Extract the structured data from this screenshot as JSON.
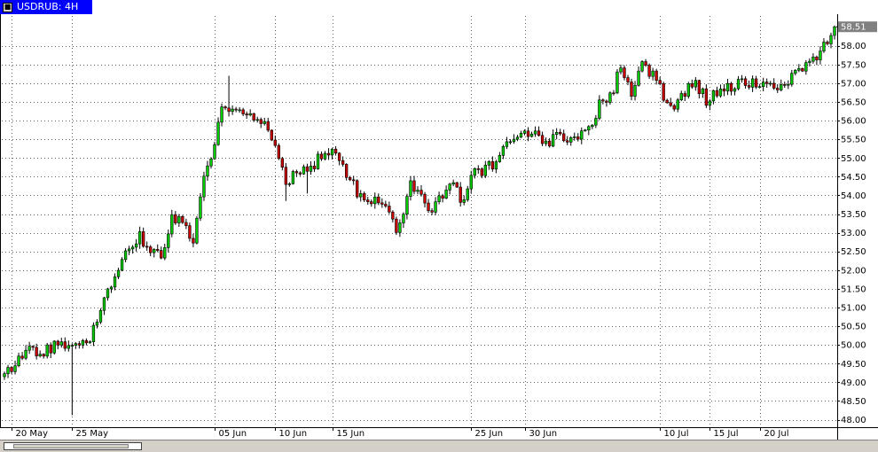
{
  "window": {
    "tab_label": "USDRUB: 4H",
    "tab_icon": "close-icon"
  },
  "chart_data": {
    "type": "candlestick",
    "symbol": "USDRUB",
    "timeframe": "4H",
    "ylim": [
      47.8,
      58.8
    ],
    "y_ticks": [
      48.0,
      48.5,
      49.0,
      49.5,
      50.0,
      50.5,
      51.0,
      51.5,
      52.0,
      52.5,
      53.0,
      53.5,
      54.0,
      54.5,
      55.0,
      55.5,
      56.0,
      56.5,
      57.0,
      57.5,
      58.0
    ],
    "y_tick_labels": [
      "48.00",
      "48.50",
      "49.00",
      "49.50",
      "50.00",
      "50.50",
      "51.00",
      "51.50",
      "52.00",
      "52.50",
      "53.00",
      "53.50",
      "54.00",
      "54.50",
      "55.00",
      "55.50",
      "56.00",
      "56.50",
      "57.00",
      "57.50",
      "58.00"
    ],
    "x_labels": [
      {
        "label": "20 May",
        "bar": 2
      },
      {
        "label": "25 May",
        "bar": 19
      },
      {
        "label": "05 Jun",
        "bar": 59
      },
      {
        "label": "10 Jun",
        "bar": 76
      },
      {
        "label": "15 Jun",
        "bar": 92
      },
      {
        "label": "25 Jun",
        "bar": 131
      },
      {
        "label": "30 Jun",
        "bar": 146
      },
      {
        "label": "10 Jul",
        "bar": 184
      },
      {
        "label": "15 Jul",
        "bar": 198
      },
      {
        "label": "20 Jul",
        "bar": 212
      }
    ],
    "current_price": "58.51",
    "current_value": 58.51,
    "up_color": "#00cc00",
    "down_color": "#cc0000",
    "grid": true,
    "bars_total": 234,
    "anchors": [
      [
        0,
        49.15
      ],
      [
        6,
        49.9
      ],
      [
        10,
        49.75
      ],
      [
        14,
        49.95
      ],
      [
        19,
        50.0
      ],
      [
        24,
        50.2
      ],
      [
        28,
        51.2
      ],
      [
        32,
        52.1
      ],
      [
        36,
        52.7
      ],
      [
        38,
        52.9
      ],
      [
        40,
        52.6
      ],
      [
        44,
        52.4
      ],
      [
        47,
        53.45
      ],
      [
        50,
        53.2
      ],
      [
        53,
        52.75
      ],
      [
        56,
        54.4
      ],
      [
        59,
        55.2
      ],
      [
        61,
        56.45
      ],
      [
        65,
        56.3
      ],
      [
        71,
        56.05
      ],
      [
        75,
        55.6
      ],
      [
        79,
        54.4
      ],
      [
        82,
        54.6
      ],
      [
        86,
        54.7
      ],
      [
        89,
        55.1
      ],
      [
        92,
        55.3
      ],
      [
        95,
        54.8
      ],
      [
        99,
        54.1
      ],
      [
        102,
        53.7
      ],
      [
        105,
        53.95
      ],
      [
        108,
        53.4
      ],
      [
        110,
        53.05
      ],
      [
        112,
        53.4
      ],
      [
        114,
        54.3
      ],
      [
        117,
        54.0
      ],
      [
        120,
        53.5
      ],
      [
        124,
        54.2
      ],
      [
        126,
        54.4
      ],
      [
        128,
        53.8
      ],
      [
        131,
        54.5
      ],
      [
        137,
        54.85
      ],
      [
        141,
        55.35
      ],
      [
        146,
        55.8
      ],
      [
        149,
        55.6
      ],
      [
        152,
        55.3
      ],
      [
        155,
        55.7
      ],
      [
        159,
        55.4
      ],
      [
        164,
        55.7
      ],
      [
        167,
        56.4
      ],
      [
        171,
        56.9
      ],
      [
        173,
        57.4
      ],
      [
        176,
        56.8
      ],
      [
        179,
        57.5
      ],
      [
        182,
        57.2
      ],
      [
        186,
        56.5
      ],
      [
        189,
        56.4
      ],
      [
        192,
        56.9
      ],
      [
        194,
        57.0
      ],
      [
        197,
        56.55
      ],
      [
        201,
        56.85
      ],
      [
        206,
        57.0
      ],
      [
        212,
        57.0
      ],
      [
        218,
        56.95
      ],
      [
        222,
        57.2
      ],
      [
        226,
        57.5
      ],
      [
        230,
        58.05
      ],
      [
        233,
        58.51
      ]
    ],
    "spikes": [
      {
        "bar": 19,
        "low": 48.12
      },
      {
        "bar": 63,
        "high": 57.2
      },
      {
        "bar": 79,
        "low": 53.85
      },
      {
        "bar": 85,
        "low": 54.05
      }
    ]
  }
}
